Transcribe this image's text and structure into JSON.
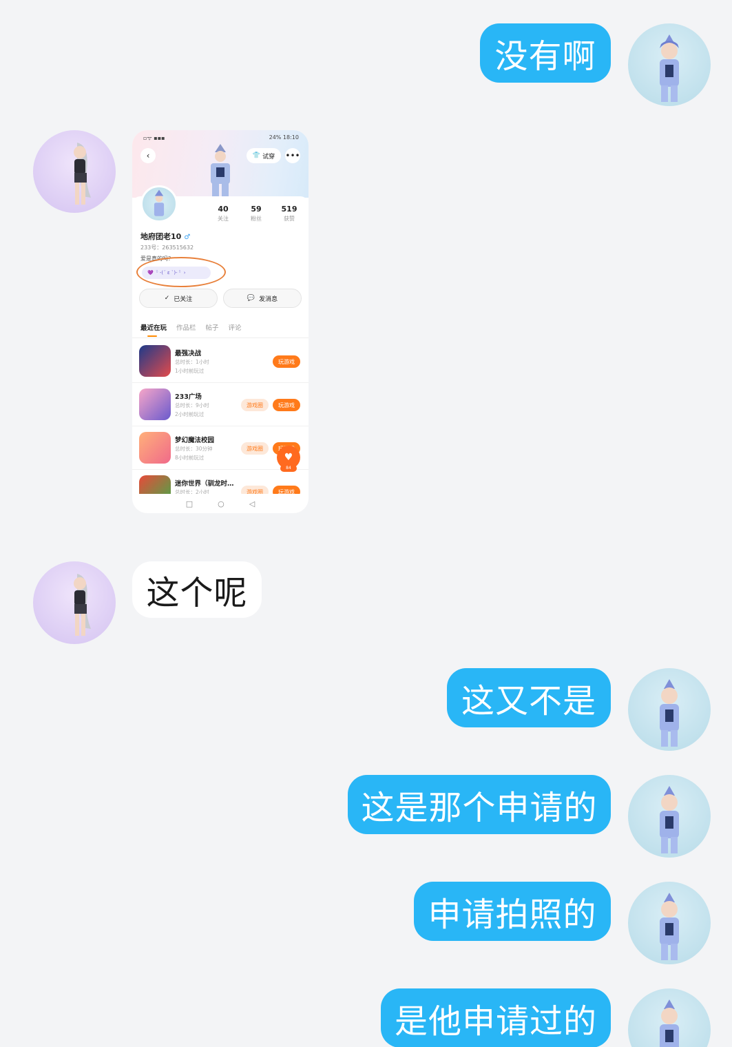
{
  "messages": [
    {
      "side": "me",
      "text": "没有啊"
    },
    {
      "side": "other",
      "type": "image"
    },
    {
      "side": "other",
      "text": "这个呢"
    },
    {
      "side": "me",
      "text": "这又不是"
    },
    {
      "side": "me",
      "text": "这是那个申请的"
    },
    {
      "side": "me",
      "text": "申请拍照的"
    },
    {
      "side": "me",
      "text": "是他申请过的"
    }
  ],
  "shot": {
    "status_right": "24%  18:10",
    "try_label": "试穿",
    "stats": [
      {
        "num": "40",
        "label": "关注"
      },
      {
        "num": "59",
        "label": "粉丝"
      },
      {
        "num": "519",
        "label": "获赞"
      }
    ],
    "name": "地府团老10",
    "gender": "♂",
    "uid": "233号：263515632",
    "bio": "爱是真的吗？",
    "tag": "ᵕ̈ -(´ ε `)- ᵕ̈",
    "followed_label": "已关注",
    "message_label": "发消息",
    "tabs": [
      "最近在玩",
      "作品栏",
      "帖子",
      "评论"
    ],
    "games": [
      {
        "name": "最强决战",
        "duration": "总时长：1小时",
        "last": "1小时前玩过",
        "circle": "",
        "play": "玩游戏"
      },
      {
        "name": "233广场",
        "duration": "总时长：9小时",
        "last": "2小时前玩过",
        "circle": "游戏圈",
        "play": "玩游戏"
      },
      {
        "name": "梦幻魔法校园",
        "duration": "总时长：30分钟",
        "last": "8小时前玩过",
        "circle": "游戏圈",
        "play": "玩游戏"
      },
      {
        "name": "迷你世界（驯龙时…",
        "duration": "总时长：2小时",
        "last": "",
        "circle": "游戏圈",
        "play": "玩游戏"
      }
    ],
    "heart_count": "84"
  }
}
